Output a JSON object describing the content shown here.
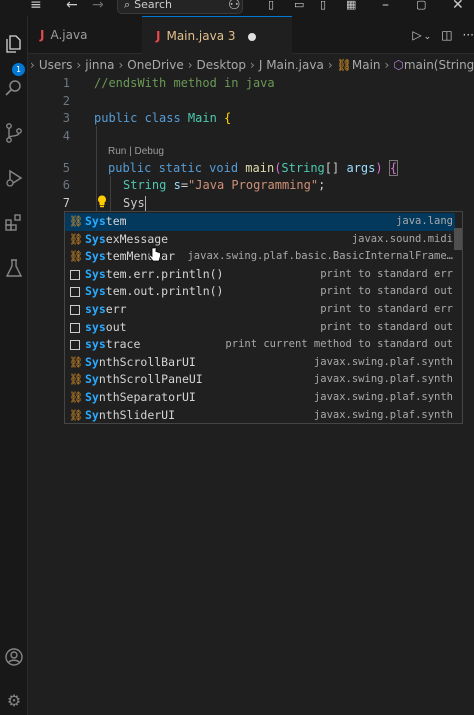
{
  "titlebar": {
    "menu_icon": "menu-icon",
    "back_icon": "arrow-left-icon",
    "forward_icon": "arrow-right-icon",
    "search_label": "Search",
    "copilot_icon": "copilot-icon"
  },
  "tabs": [
    {
      "label": "A.java",
      "icon": "J",
      "active": false
    },
    {
      "label": "Main.java 3",
      "icon": "J",
      "active": true,
      "modified": true
    }
  ],
  "breadcrumb": [
    "Users",
    "jinna",
    "OneDrive",
    "Desktop",
    "J Main.java",
    "Main",
    "main(String[])"
  ],
  "activity_badge": "1",
  "editor": {
    "line_numbers": [
      "1",
      "2",
      "3",
      "4",
      "5",
      "6",
      "7"
    ],
    "codelens": "Run | Debug",
    "lines": {
      "l1": "//endsWith method in java",
      "l3_kw": "public class ",
      "l3_name": "Main",
      "l3_brace": " {",
      "l5_kw": "public static void ",
      "l5_fn": "main",
      "l5_paren": "(",
      "l5_type": "String",
      "l5_rest": "[] ",
      "l5_var": "args",
      "l5_close": ") ",
      "l5_brace": "{",
      "l6_type": "String ",
      "l6_var": "s",
      "l6_eq": "=",
      "l6_str": "\"Java Programming\"",
      "l6_semi": ";",
      "l7": "Sys"
    }
  },
  "suggestions": [
    {
      "kind": "class",
      "match": "Sys",
      "rest": "tem",
      "detail": "java.lang",
      "selected": true
    },
    {
      "kind": "class",
      "match": "Sys",
      "rest": "exMessage",
      "detail": "javax.sound.midi",
      "selected": false
    },
    {
      "kind": "class",
      "match": "Sys",
      "rest": "temMenuBar",
      "detail": "javax.swing.plaf.basic.BasicInternalFrame…",
      "selected": false
    },
    {
      "kind": "snippet",
      "match": "Sys",
      "rest": "tem.err.println()",
      "detail": "print to standard err",
      "selected": false
    },
    {
      "kind": "snippet",
      "match": "Sys",
      "rest": "tem.out.println()",
      "detail": "print to standard out",
      "selected": false
    },
    {
      "kind": "snippet",
      "match": "sys",
      "rest": "err",
      "detail": "print to standard err",
      "selected": false
    },
    {
      "kind": "snippet",
      "match": "sys",
      "rest": "out",
      "detail": "print to standard out",
      "selected": false
    },
    {
      "kind": "snippet",
      "match": "sys",
      "rest": "trace",
      "detail": "print current method to standard out",
      "selected": false
    },
    {
      "kind": "class",
      "match": "Sy",
      "rest": "nthScrollBarUI",
      "detail": "javax.swing.plaf.synth",
      "selected": false
    },
    {
      "kind": "class",
      "match": "Sy",
      "rest": "nthScrollPaneUI",
      "detail": "javax.swing.plaf.synth",
      "selected": false
    },
    {
      "kind": "class",
      "match": "Sy",
      "rest": "nthSeparatorUI",
      "detail": "javax.swing.plaf.synth",
      "selected": false
    },
    {
      "kind": "class",
      "match": "Sy",
      "rest": "nthSliderUI",
      "detail": "javax.swing.plaf.synth",
      "selected": false
    }
  ]
}
